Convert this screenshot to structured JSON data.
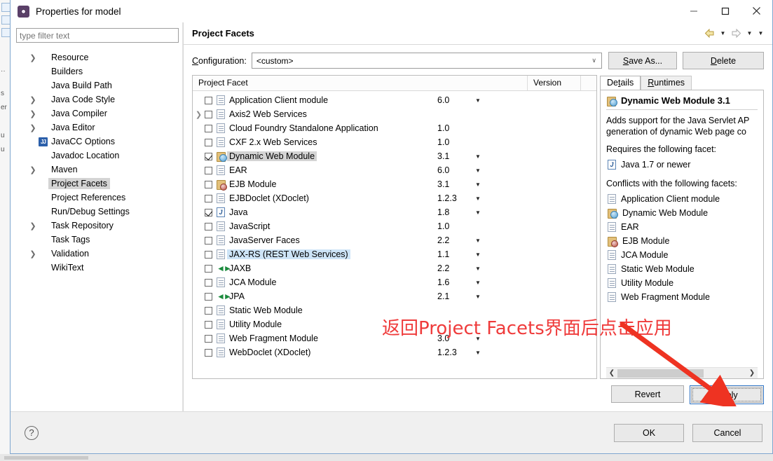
{
  "window": {
    "title": "Properties for model",
    "minimize_label": "—",
    "maximize_label": "□",
    "close_label": "✕"
  },
  "sidebar": {
    "filter_placeholder": "type filter text",
    "filter_value": "",
    "items": [
      {
        "label": "Resource",
        "expandable": true,
        "icon": "none",
        "selected": false
      },
      {
        "label": "Builders",
        "expandable": false,
        "icon": "none",
        "selected": false
      },
      {
        "label": "Java Build Path",
        "expandable": false,
        "icon": "none",
        "selected": false
      },
      {
        "label": "Java Code Style",
        "expandable": true,
        "icon": "none",
        "selected": false
      },
      {
        "label": "Java Compiler",
        "expandable": true,
        "icon": "none",
        "selected": false
      },
      {
        "label": "Java Editor",
        "expandable": true,
        "icon": "none",
        "selected": false
      },
      {
        "label": "JavaCC Options",
        "expandable": false,
        "icon": "javacc-icon",
        "selected": false
      },
      {
        "label": "Javadoc Location",
        "expandable": false,
        "icon": "none",
        "selected": false
      },
      {
        "label": "Maven",
        "expandable": true,
        "icon": "none",
        "selected": false
      },
      {
        "label": "Project Facets",
        "expandable": false,
        "icon": "none",
        "selected": true
      },
      {
        "label": "Project References",
        "expandable": false,
        "icon": "none",
        "selected": false
      },
      {
        "label": "Run/Debug Settings",
        "expandable": false,
        "icon": "none",
        "selected": false
      },
      {
        "label": "Task Repository",
        "expandable": true,
        "icon": "none",
        "selected": false
      },
      {
        "label": "Task Tags",
        "expandable": false,
        "icon": "none",
        "selected": false
      },
      {
        "label": "Validation",
        "expandable": true,
        "icon": "none",
        "selected": false
      },
      {
        "label": "WikiText",
        "expandable": false,
        "icon": "none",
        "selected": false
      }
    ]
  },
  "pane": {
    "title": "Project Facets",
    "back_icon": "back-arrow-icon",
    "forward_icon": "forward-arrow-icon",
    "menu_icon": "chevron-down-icon"
  },
  "configuration": {
    "label": "Configuration:",
    "label_mnemonic": "C",
    "value": "<custom>",
    "save_as_label": "Save As...",
    "save_as_mnemonic": "S",
    "delete_label": "Delete",
    "delete_mnemonic": "D"
  },
  "facets_table": {
    "columns": [
      "Project Facet",
      "Version"
    ],
    "rows": [
      {
        "name": "Application Client module",
        "version": "6.0",
        "checked": false,
        "expandable": false,
        "icon": "doc-icon",
        "has_dropdown": true,
        "highlight": "none"
      },
      {
        "name": "Axis2 Web Services",
        "version": "",
        "checked": false,
        "expandable": true,
        "icon": "doc-icon",
        "has_dropdown": false,
        "highlight": "none"
      },
      {
        "name": "Cloud Foundry Standalone Application",
        "version": "1.0",
        "checked": false,
        "expandable": false,
        "icon": "doc-icon",
        "has_dropdown": false,
        "highlight": "none"
      },
      {
        "name": "CXF 2.x Web Services",
        "version": "1.0",
        "checked": false,
        "expandable": false,
        "icon": "doc-icon",
        "has_dropdown": false,
        "highlight": "none"
      },
      {
        "name": "Dynamic Web Module",
        "version": "3.1",
        "checked": true,
        "expandable": false,
        "icon": "web-module-icon",
        "has_dropdown": true,
        "highlight": "gray"
      },
      {
        "name": "EAR",
        "version": "6.0",
        "checked": false,
        "expandable": false,
        "icon": "doc-icon",
        "has_dropdown": true,
        "highlight": "none"
      },
      {
        "name": "EJB Module",
        "version": "3.1",
        "checked": false,
        "expandable": false,
        "icon": "ejb-module-icon",
        "has_dropdown": true,
        "highlight": "none"
      },
      {
        "name": "EJBDoclet (XDoclet)",
        "version": "1.2.3",
        "checked": false,
        "expandable": false,
        "icon": "doc-icon",
        "has_dropdown": true,
        "highlight": "none"
      },
      {
        "name": "Java",
        "version": "1.8",
        "checked": true,
        "expandable": false,
        "icon": "java-icon",
        "has_dropdown": true,
        "highlight": "none"
      },
      {
        "name": "JavaScript",
        "version": "1.0",
        "checked": false,
        "expandable": false,
        "icon": "doc-icon",
        "has_dropdown": false,
        "highlight": "none"
      },
      {
        "name": "JavaServer Faces",
        "version": "2.2",
        "checked": false,
        "expandable": false,
        "icon": "doc-icon",
        "has_dropdown": true,
        "highlight": "none"
      },
      {
        "name": "JAX-RS (REST Web Services)",
        "version": "1.1",
        "checked": false,
        "expandable": false,
        "icon": "doc-icon",
        "has_dropdown": true,
        "highlight": "blue"
      },
      {
        "name": "JAXB",
        "version": "2.2",
        "checked": false,
        "expandable": false,
        "icon": "jaxb-icon",
        "has_dropdown": true,
        "highlight": "none"
      },
      {
        "name": "JCA Module",
        "version": "1.6",
        "checked": false,
        "expandable": false,
        "icon": "doc-icon",
        "has_dropdown": true,
        "highlight": "none"
      },
      {
        "name": "JPA",
        "version": "2.1",
        "checked": false,
        "expandable": false,
        "icon": "jaxb-icon",
        "has_dropdown": true,
        "highlight": "none"
      },
      {
        "name": "Static Web Module",
        "version": "",
        "checked": false,
        "expandable": false,
        "icon": "doc-icon",
        "has_dropdown": false,
        "highlight": "none"
      },
      {
        "name": "Utility Module",
        "version": "",
        "checked": false,
        "expandable": false,
        "icon": "doc-icon",
        "has_dropdown": false,
        "highlight": "none"
      },
      {
        "name": "Web Fragment Module",
        "version": "3.0",
        "checked": false,
        "expandable": false,
        "icon": "doc-icon",
        "has_dropdown": true,
        "highlight": "none"
      },
      {
        "name": "WebDoclet (XDoclet)",
        "version": "1.2.3",
        "checked": false,
        "expandable": false,
        "icon": "doc-icon",
        "has_dropdown": true,
        "highlight": "none"
      }
    ]
  },
  "details": {
    "tabs": [
      {
        "label": "Details",
        "mnemonic": "t",
        "active": true
      },
      {
        "label": "Runtimes",
        "mnemonic": "R",
        "active": false
      }
    ],
    "heading": "Dynamic Web Module 3.1",
    "heading_icon": "web-module-icon",
    "description_line1": "Adds support for the Java Servlet AP",
    "description_line2": "generation of dynamic Web page co",
    "requires_label": "Requires the following facet:",
    "requires": [
      {
        "label": "Java 1.7 or newer",
        "icon": "java-icon"
      }
    ],
    "conflicts_label": "Conflicts with the following facets:",
    "conflicts": [
      {
        "label": "Application Client module",
        "icon": "doc-icon"
      },
      {
        "label": "Dynamic Web Module",
        "icon": "web-module-icon"
      },
      {
        "label": "EAR",
        "icon": "doc-icon"
      },
      {
        "label": "EJB Module",
        "icon": "ejb-module-icon"
      },
      {
        "label": "JCA Module",
        "icon": "doc-icon"
      },
      {
        "label": "Static Web Module",
        "icon": "doc-icon"
      },
      {
        "label": "Utility Module",
        "icon": "doc-icon"
      },
      {
        "label": "Web Fragment Module",
        "icon": "doc-icon"
      }
    ],
    "scroll_left_icon": "chevron-left-icon",
    "scroll_right_icon": "chevron-right-icon"
  },
  "buttons": {
    "revert": "Revert",
    "apply": "Apply",
    "apply_mnemonic": "A",
    "ok": "OK",
    "cancel": "Cancel",
    "help_icon": "question-mark-icon"
  },
  "annotation": {
    "text": "返回Project Facets界面后点击应用",
    "color": "#ef3b3b",
    "arrow": "red-arrow-pointing-to-apply"
  }
}
